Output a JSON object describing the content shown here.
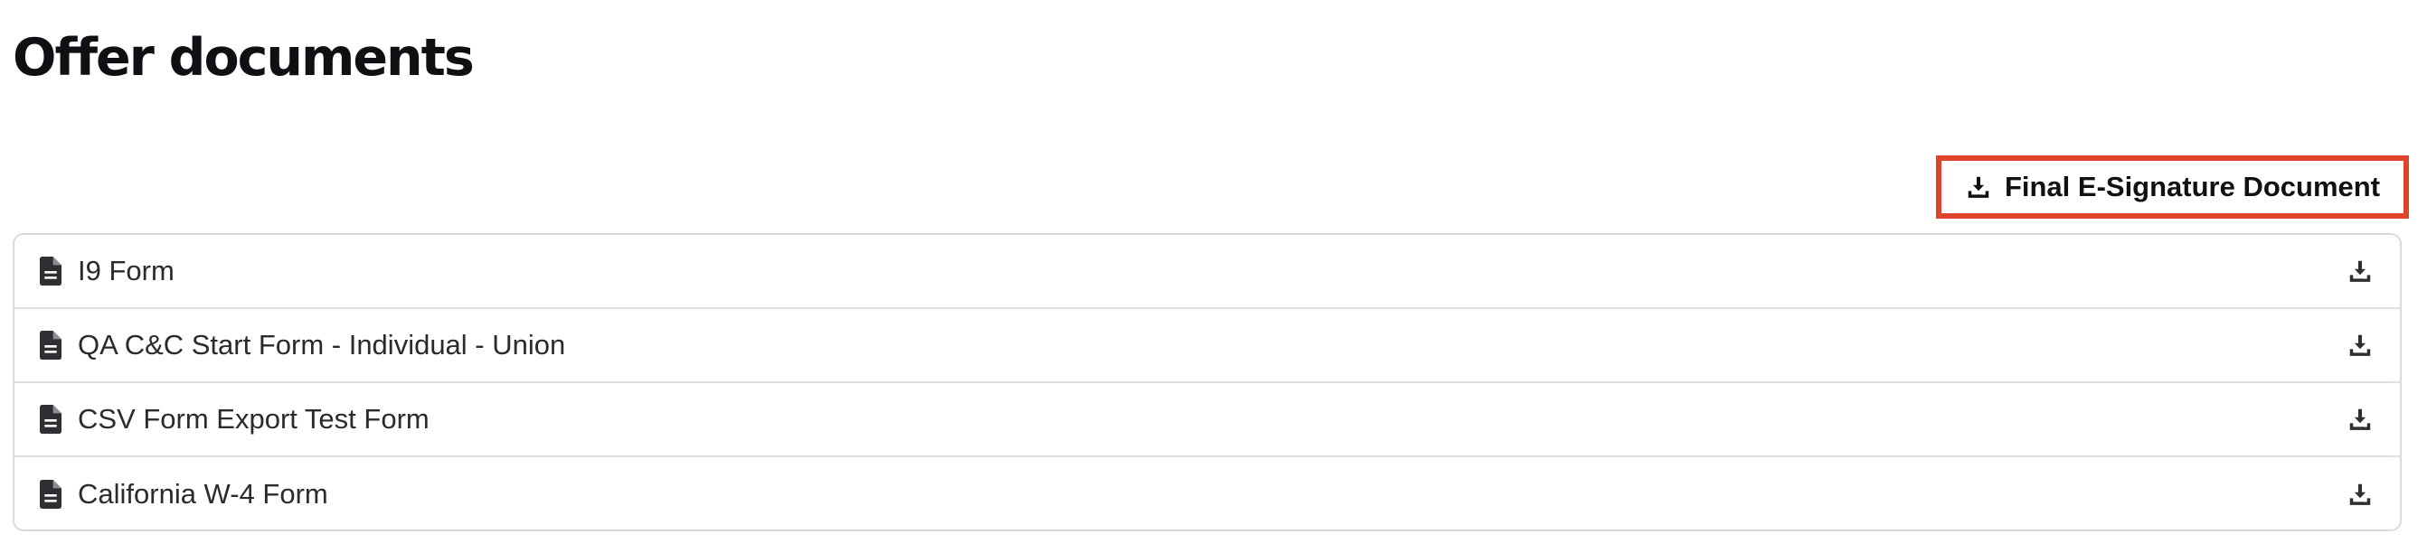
{
  "header": {
    "title": "Offer documents"
  },
  "final_document": {
    "label": "Final E-Signature Document",
    "icon": "download-icon",
    "highlight_color": "#e0432c"
  },
  "documents": [
    {
      "name": "I9 Form",
      "icon": "file-icon",
      "action_icon": "download-icon"
    },
    {
      "name": "QA C&C Start Form - Individual - Union",
      "icon": "file-icon",
      "action_icon": "download-icon"
    },
    {
      "name": "CSV Form Export Test Form",
      "icon": "file-icon",
      "action_icon": "download-icon"
    },
    {
      "name": "California W-4 Form",
      "icon": "file-icon",
      "action_icon": "download-icon"
    }
  ]
}
